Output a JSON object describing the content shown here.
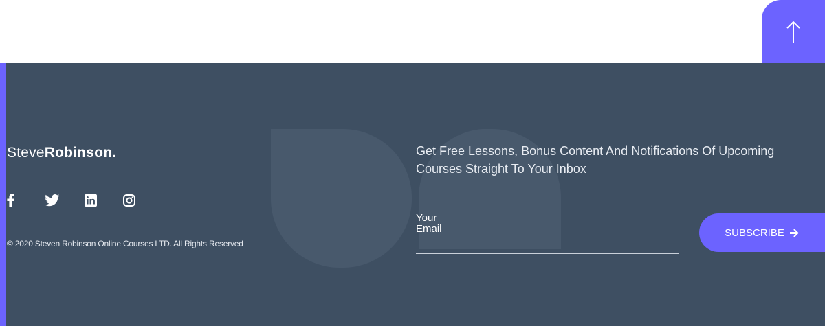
{
  "scroll_top": {
    "icon": "arrow-up-icon"
  },
  "footer": {
    "brand": {
      "first": "Steve",
      "last": "Robinson."
    },
    "social": [
      {
        "name": "facebook-icon"
      },
      {
        "name": "twitter-icon"
      },
      {
        "name": "linkedin-icon"
      },
      {
        "name": "instagram-icon"
      }
    ],
    "copyright": "© 2020 Steven Robinson Online Courses LTD. All Rights Reserved",
    "newsletter": {
      "text": "Get Free Lessons, Bonus Content And Notifications Of Upcoming Courses Straight To Your Inbox",
      "email_label": "Your Email",
      "email_value": "",
      "subscribe_label": "SUBSCRIBE"
    }
  },
  "colors": {
    "accent": "#6c63ff",
    "footer_bg": "#3e4f62"
  }
}
